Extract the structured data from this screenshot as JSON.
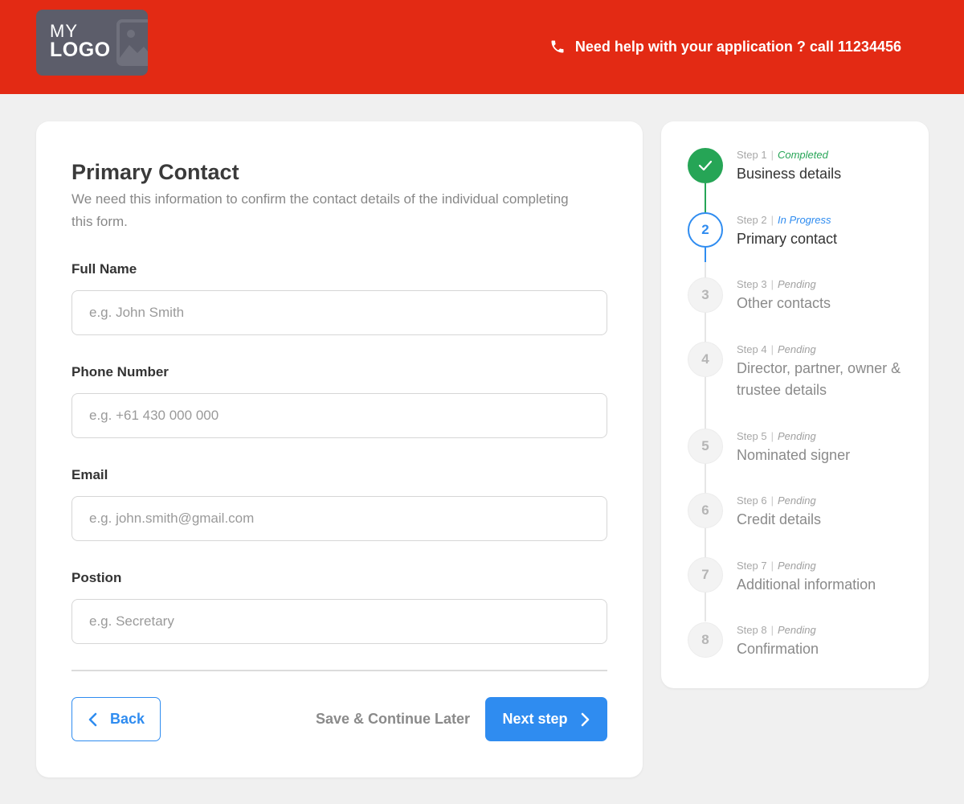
{
  "header": {
    "logo_top": "MY",
    "logo_bottom": "LOGO",
    "help_text": "Need help with your application ? call 11234456"
  },
  "form": {
    "title": "Primary Contact",
    "description": "We need this information to confirm the contact details of the individual completing this form.",
    "fields": [
      {
        "label": "Full Name",
        "placeholder": "e.g. John Smith",
        "value": ""
      },
      {
        "label": "Phone Number",
        "placeholder": "e.g. +61 430 000 000",
        "value": ""
      },
      {
        "label": "Email",
        "placeholder": "e.g. john.smith@gmail.com",
        "value": ""
      },
      {
        "label": "Postion",
        "placeholder": "e.g. Secretary",
        "value": ""
      }
    ],
    "back_label": "Back",
    "save_later_label": "Save & Continue Later",
    "next_label": "Next step"
  },
  "steps": [
    {
      "number": "1",
      "step_label": "Step 1",
      "status": "Completed",
      "name": "Business details"
    },
    {
      "number": "2",
      "step_label": "Step 2",
      "status": "In Progress",
      "name": "Primary contact"
    },
    {
      "number": "3",
      "step_label": "Step 3",
      "status": "Pending",
      "name": "Other contacts"
    },
    {
      "number": "4",
      "step_label": "Step 4",
      "status": "Pending",
      "name": "Director, partner, owner & trustee details"
    },
    {
      "number": "5",
      "step_label": "Step 5",
      "status": "Pending",
      "name": "Nominated signer"
    },
    {
      "number": "6",
      "step_label": "Step 6",
      "status": "Pending",
      "name": "Credit details"
    },
    {
      "number": "7",
      "step_label": "Step 7",
      "status": "Pending",
      "name": "Additional information"
    },
    {
      "number": "8",
      "step_label": "Step 8",
      "status": "Pending",
      "name": "Confirmation"
    }
  ],
  "colors": {
    "brand_red": "#e32a14",
    "primary_blue": "#2f8cf0",
    "success_green": "#26a556",
    "pending_gray": "#b5b5b5"
  },
  "icons": {
    "phone": "phone-icon",
    "check": "check-icon",
    "back": "chevron-left-icon",
    "next": "chevron-right-icon",
    "logo_image": "image-placeholder-icon"
  }
}
